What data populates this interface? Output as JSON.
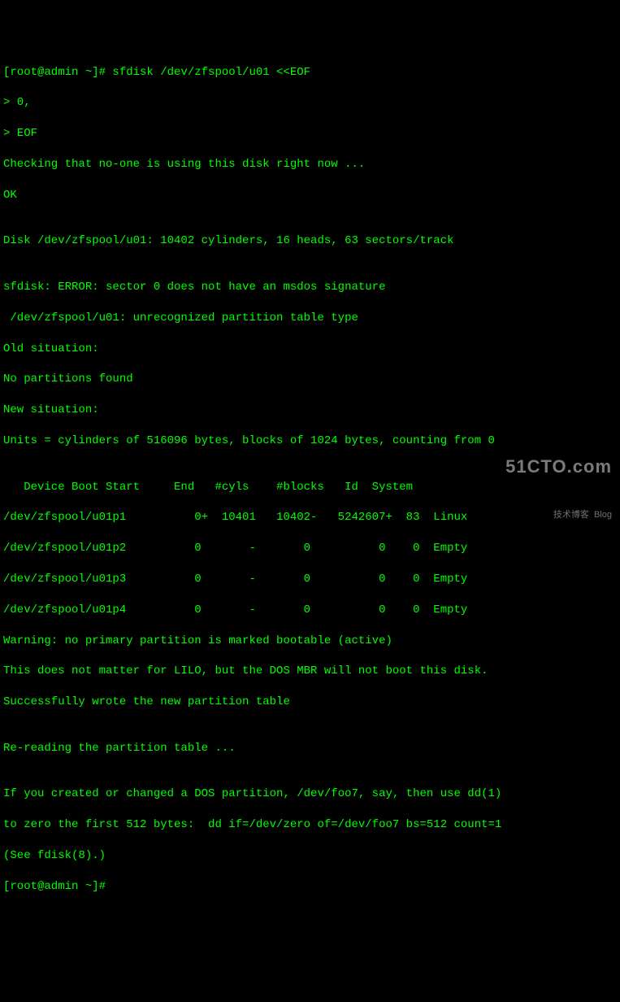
{
  "lines": {
    "l1": "[root@admin ~]# sfdisk /dev/zfspool/u01 <<EOF",
    "l2": "> 0,",
    "l3": "> EOF",
    "l4": "Checking that no-one is using this disk right now ...",
    "l5": "OK",
    "l6": "",
    "l7": "Disk /dev/zfspool/u01: 10402 cylinders, 16 heads, 63 sectors/track",
    "l8": "",
    "l9": "sfdisk: ERROR: sector 0 does not have an msdos signature",
    "l10": " /dev/zfspool/u01: unrecognized partition table type",
    "l11": "Old situation:",
    "l12": "No partitions found",
    "l13": "New situation:",
    "l14": "Units = cylinders of 516096 bytes, blocks of 1024 bytes, counting from 0",
    "l15": "",
    "l16": "   Device Boot Start     End   #cyls    #blocks   Id  System",
    "l17": "/dev/zfspool/u01p1          0+  10401   10402-   5242607+  83  Linux",
    "l18": "/dev/zfspool/u01p2          0       -       0          0    0  Empty",
    "l19": "/dev/zfspool/u01p3          0       -       0          0    0  Empty",
    "l20": "/dev/zfspool/u01p4          0       -       0          0    0  Empty",
    "l21": "Warning: no primary partition is marked bootable (active)",
    "l22": "This does not matter for LILO, but the DOS MBR will not boot this disk.",
    "l23": "Successfully wrote the new partition table",
    "l24": "",
    "l25": "Re-reading the partition table ...",
    "l26": "",
    "l27": "If you created or changed a DOS partition, /dev/foo7, say, then use dd(1)",
    "l28": "to zero the first 512 bytes:  dd if=/dev/zero of=/dev/foo7 bs=512 count=1",
    "l29": "(See fdisk(8).)",
    "l30": "[root@admin ~]# "
  },
  "watermark": {
    "big": "51CTO.com",
    "small": "技术博客  Blog"
  },
  "chart_data": {
    "type": "table",
    "title": "Partition table for /dev/zfspool/u01",
    "columns": [
      "Device",
      "Boot",
      "Start",
      "End",
      "#cyls",
      "#blocks",
      "Id",
      "System"
    ],
    "rows": [
      {
        "Device": "/dev/zfspool/u01p1",
        "Boot": "",
        "Start": "0+",
        "End": "10401",
        "#cyls": "10402-",
        "#blocks": "5242607+",
        "Id": "83",
        "System": "Linux"
      },
      {
        "Device": "/dev/zfspool/u01p2",
        "Boot": "",
        "Start": "0",
        "End": "-",
        "#cyls": "0",
        "#blocks": "0",
        "Id": "0",
        "System": "Empty"
      },
      {
        "Device": "/dev/zfspool/u01p3",
        "Boot": "",
        "Start": "0",
        "End": "-",
        "#cyls": "0",
        "#blocks": "0",
        "Id": "0",
        "System": "Empty"
      },
      {
        "Device": "/dev/zfspool/u01p4",
        "Boot": "",
        "Start": "0",
        "End": "-",
        "#cyls": "0",
        "#blocks": "0",
        "Id": "0",
        "System": "Empty"
      }
    ],
    "disk_info": {
      "device": "/dev/zfspool/u01",
      "cylinders": 10402,
      "heads": 16,
      "sectors_per_track": 63
    },
    "units": "cylinders of 516096 bytes, blocks of 1024 bytes, counting from 0"
  }
}
